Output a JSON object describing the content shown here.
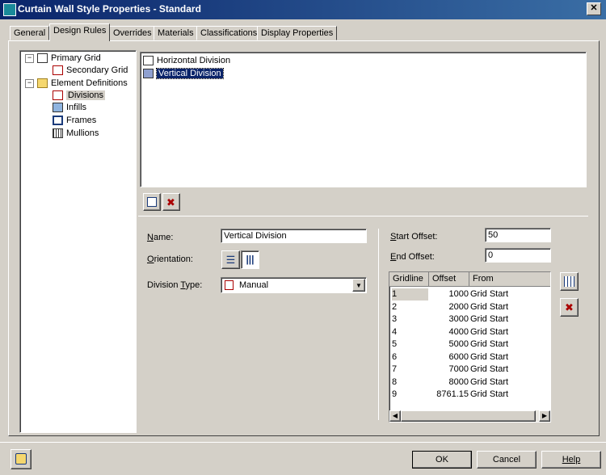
{
  "window": {
    "title": "Curtain Wall Style Properties - Standard",
    "close_glyph": "✕"
  },
  "tabs": [
    {
      "label": "General"
    },
    {
      "label": "Design Rules"
    },
    {
      "label": "Overrides"
    },
    {
      "label": "Materials"
    },
    {
      "label": "Classifications"
    },
    {
      "label": "Display Properties"
    }
  ],
  "tree": {
    "primary_grid": "Primary Grid",
    "secondary_grid": "Secondary Grid",
    "element_definitions": "Element Definitions",
    "divisions": "Divisions",
    "infills": "Infills",
    "frames": "Frames",
    "mullions": "Mullions"
  },
  "division_list": [
    "Horizontal Division",
    "Vertical Division"
  ],
  "form": {
    "name_label_u": "N",
    "name_label_rest": "ame:",
    "name_value": "Vertical Division",
    "orientation_label_u": "O",
    "orientation_label_rest": "rientation:",
    "division_type_label_pre": "Division ",
    "division_type_label_u": "T",
    "division_type_label_rest": "ype:",
    "division_type_value": "Manual",
    "start_offset_label_u": "S",
    "start_offset_label_rest": "tart Offset:",
    "start_offset_value": "50",
    "end_offset_label_u": "E",
    "end_offset_label_rest": "nd Offset:",
    "end_offset_value": "0"
  },
  "gridlines": {
    "columns": [
      "Gridline",
      "Offset",
      "From"
    ],
    "rows": [
      {
        "gridline": "1",
        "offset": "1000",
        "from": "Grid Start"
      },
      {
        "gridline": "2",
        "offset": "2000",
        "from": "Grid Start"
      },
      {
        "gridline": "3",
        "offset": "3000",
        "from": "Grid Start"
      },
      {
        "gridline": "4",
        "offset": "4000",
        "from": "Grid Start"
      },
      {
        "gridline": "5",
        "offset": "5000",
        "from": "Grid Start"
      },
      {
        "gridline": "6",
        "offset": "6000",
        "from": "Grid Start"
      },
      {
        "gridline": "7",
        "offset": "7000",
        "from": "Grid Start"
      },
      {
        "gridline": "8",
        "offset": "8000",
        "from": "Grid Start"
      },
      {
        "gridline": "9",
        "offset": "8761.15",
        "from": "Grid Start"
      }
    ]
  },
  "buttons": {
    "ok": "OK",
    "cancel": "Cancel",
    "help": "Help"
  }
}
